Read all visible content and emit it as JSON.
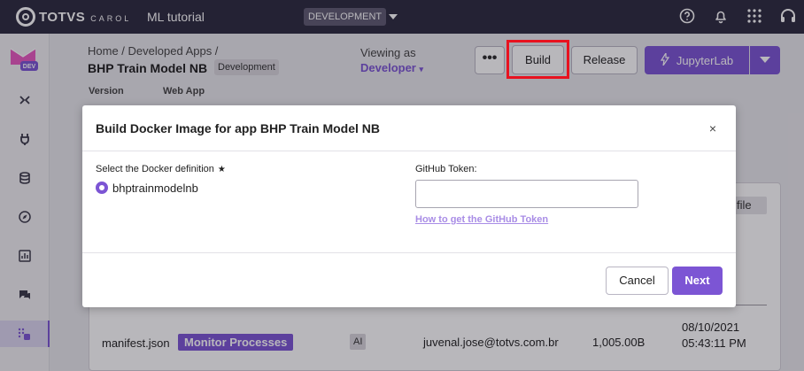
{
  "topbar": {
    "brand_name": "TOTVS",
    "brand_sub": "CAROL",
    "app_name": "ML tutorial",
    "environment": "DEVELOPMENT",
    "icons": [
      "help-icon",
      "bell-icon",
      "apps-grid-icon",
      "headset-icon"
    ]
  },
  "sidebar": {
    "logo_badge": "DEV",
    "items": [
      "flow-icon",
      "plug-icon",
      "database-icon",
      "compass-icon",
      "chart-icon",
      "chat-icon",
      "apps-icon"
    ],
    "active_item": "apps-icon"
  },
  "header": {
    "breadcrumb": "Home / Developed Apps /",
    "title": "BHP Train Model NB",
    "title_badge": "Development",
    "viewing_label": "Viewing as",
    "viewing_value": "Developer",
    "more_label": "•••",
    "build_label": "Build",
    "release_label": "Release",
    "jupyter_label": "JupyterLab"
  },
  "tabs": [
    "Version",
    "Web App"
  ],
  "background_table": {
    "file_button": "file",
    "row": {
      "file": "manifest.json",
      "process": "Monitor Processes",
      "badge": "AI",
      "email": "juvenal.jose@totvs.com.br",
      "size": "1,005.00B",
      "date": "08/10/2021 05:43:11 PM"
    }
  },
  "modal": {
    "title": "Build Docker Image for app BHP Train Model NB",
    "close": "×",
    "docker_label": "Select the Docker definition",
    "docker_required": "★",
    "docker_option": "bhptrainmodelnb",
    "token_label": "GitHub Token:",
    "token_value": "",
    "token_link": "How to get the GitHub Token",
    "cancel_label": "Cancel",
    "next_label": "Next"
  },
  "colors": {
    "topbar": "#2c2a3e",
    "accent": "#7c55d4",
    "highlight": "#e8121f"
  }
}
